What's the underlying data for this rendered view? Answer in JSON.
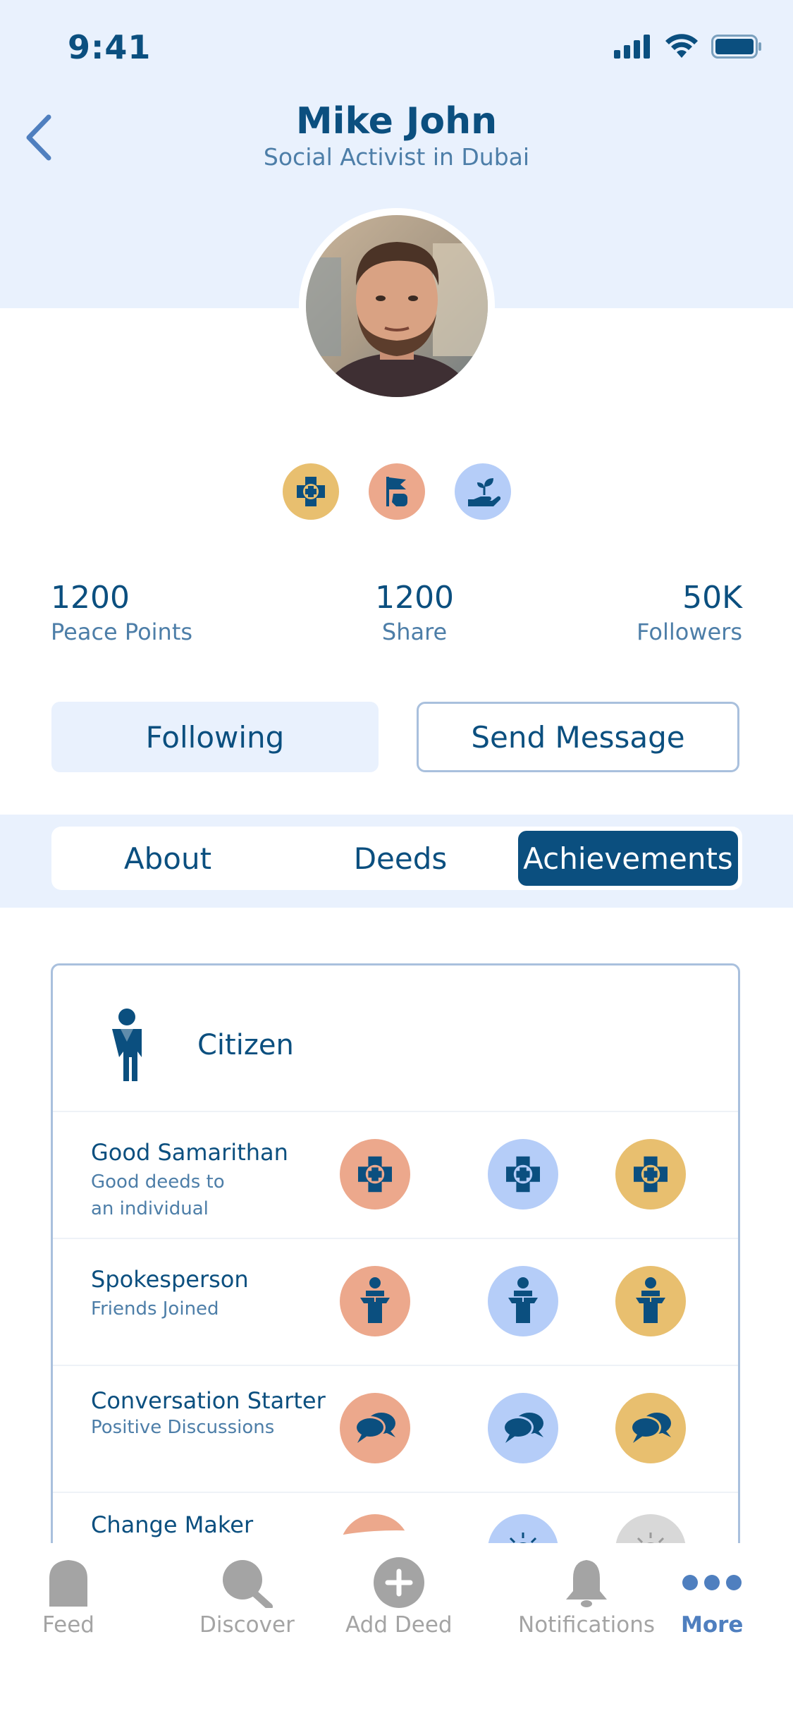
{
  "status_bar": {
    "time": "9:41"
  },
  "profile": {
    "name": "Mike John",
    "subtitle": "Social Activist in Dubai"
  },
  "badges": [
    {
      "icon": "first-aid-icon",
      "color": "#e8bf6f"
    },
    {
      "icon": "flag-icon",
      "color": "#eca88c"
    },
    {
      "icon": "plant-hand-icon",
      "color": "#b5cdf8"
    }
  ],
  "stats": [
    {
      "value": "1200",
      "label": "Peace Points"
    },
    {
      "value": "1200",
      "label": "Share"
    },
    {
      "value": "50K",
      "label": "Followers"
    }
  ],
  "actions": {
    "following": "Following",
    "send_message": "Send Message"
  },
  "tabs": {
    "about": "About",
    "deeds": "Deeds",
    "achievements": "Achievements",
    "active": "Achievements"
  },
  "achievements": {
    "level": "Citizen",
    "items": [
      {
        "title": "Good Samarithan",
        "desc": "Good deeds to an individual",
        "icon": "first-aid-icon",
        "medals": [
          "#eca88c",
          "#b5cdf8",
          "#e8bf6f"
        ]
      },
      {
        "title": "Spokesperson",
        "desc": "Friends Joined",
        "icon": "podium-icon",
        "medals": [
          "#eca88c",
          "#b5cdf8",
          "#e8bf6f"
        ]
      },
      {
        "title": "Conversation Starter",
        "desc": "Positive Discussions",
        "icon": "chat-bubbles-icon",
        "medals": [
          "#eca88c",
          "#b5cdf8",
          "#e8bf6f"
        ]
      },
      {
        "title": "Change Maker",
        "desc": "",
        "icon": "lightbulb-icon",
        "medals": [
          "#eca88c",
          "#b5cdf8",
          "#d8d8d8"
        ]
      }
    ]
  },
  "nav": {
    "feed": "Feed",
    "discover": "Discover",
    "add_deed": "Add Deed",
    "notifications": "Notifications",
    "more": "More",
    "active": "More"
  },
  "colors": {
    "primary": "#0b4f7f",
    "secondary_text": "#4d7ea8",
    "header_bg": "#e9f1fd",
    "accent": "#4f7fbf"
  }
}
